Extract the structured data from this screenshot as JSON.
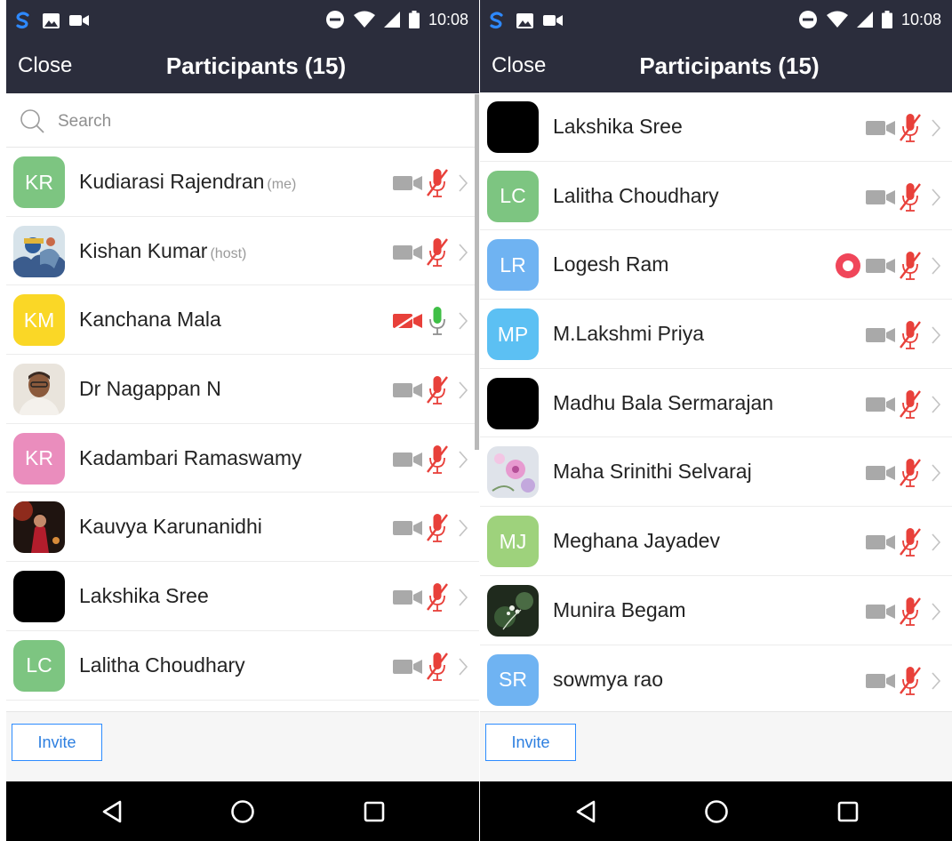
{
  "status_bar": {
    "time": "10:08"
  },
  "header": {
    "close_label": "Close",
    "title": "Participants (15)"
  },
  "search": {
    "placeholder": "Search"
  },
  "left_participants": [
    {
      "initials": "KR",
      "avatar_type": "initials",
      "color": "#7dc581",
      "name": "Kudiarasi Rajendran",
      "role": "(me)",
      "video": "off",
      "audio": "muted"
    },
    {
      "initials": "",
      "avatar_type": "photo-art",
      "color": "",
      "name": "Kishan Kumar",
      "role": "(host)",
      "video": "off",
      "audio": "muted"
    },
    {
      "initials": "KM",
      "avatar_type": "initials",
      "color": "#fad726",
      "name": "Kanchana Mala",
      "role": "",
      "video": "disabled",
      "audio": "unmuted"
    },
    {
      "initials": "",
      "avatar_type": "photo-portrait",
      "color": "",
      "name": "Dr Nagappan N",
      "role": "",
      "video": "off",
      "audio": "muted"
    },
    {
      "initials": "KR",
      "avatar_type": "initials",
      "color": "#ea8dbd",
      "name": "Kadambari Ramaswamy",
      "role": "",
      "video": "off",
      "audio": "muted"
    },
    {
      "initials": "",
      "avatar_type": "photo-dark",
      "color": "",
      "name": "Kauvya Karunanidhi",
      "role": "",
      "video": "off",
      "audio": "muted"
    },
    {
      "initials": "",
      "avatar_type": "black",
      "color": "#000000",
      "name": "Lakshika Sree",
      "role": "",
      "video": "off",
      "audio": "muted"
    },
    {
      "initials": "LC",
      "avatar_type": "initials",
      "color": "#7dc581",
      "name": "Lalitha Choudhary",
      "role": "",
      "video": "off",
      "audio": "muted"
    }
  ],
  "right_participants": [
    {
      "initials": "",
      "avatar_type": "black",
      "color": "#000000",
      "name": "Lakshika Sree",
      "role": "",
      "video": "off",
      "audio": "muted"
    },
    {
      "initials": "LC",
      "avatar_type": "initials",
      "color": "#7dc581",
      "name": "Lalitha Choudhary",
      "role": "",
      "video": "off",
      "audio": "muted"
    },
    {
      "initials": "LR",
      "avatar_type": "initials",
      "color": "#6fb3f2",
      "name": "Logesh Ram",
      "role": "",
      "video": "off",
      "audio": "muted",
      "recording": true
    },
    {
      "initials": "MP",
      "avatar_type": "initials",
      "color": "#5cc0f3",
      "name": "M.Lakshmi Priya",
      "role": "",
      "video": "off",
      "audio": "muted"
    },
    {
      "initials": "",
      "avatar_type": "black",
      "color": "#000000",
      "name": "Madhu Bala Sermarajan",
      "role": "",
      "video": "off",
      "audio": "muted"
    },
    {
      "initials": "",
      "avatar_type": "photo-flower",
      "color": "",
      "name": "Maha Srinithi Selvaraj",
      "role": "",
      "video": "off",
      "audio": "muted"
    },
    {
      "initials": "MJ",
      "avatar_type": "initials",
      "color": "#9ed27c",
      "name": "Meghana Jayadev",
      "role": "",
      "video": "off",
      "audio": "muted"
    },
    {
      "initials": "",
      "avatar_type": "photo-plant",
      "color": "",
      "name": "Munira Begam",
      "role": "",
      "video": "off",
      "audio": "muted"
    },
    {
      "initials": "SR",
      "avatar_type": "initials",
      "color": "#6fb3f2",
      "name": "sowmya rao",
      "role": "",
      "video": "off",
      "audio": "muted"
    }
  ],
  "footer": {
    "invite_label": "Invite"
  },
  "colors": {
    "header_bg": "#2b2d3c",
    "muted_mic": "#e8403a",
    "unmuted_mic": "#3fbf46",
    "video_off": "#a9a9a9",
    "video_disabled": "#e8403a",
    "invite_border": "#2d8cff",
    "recording": "#f0465a"
  }
}
